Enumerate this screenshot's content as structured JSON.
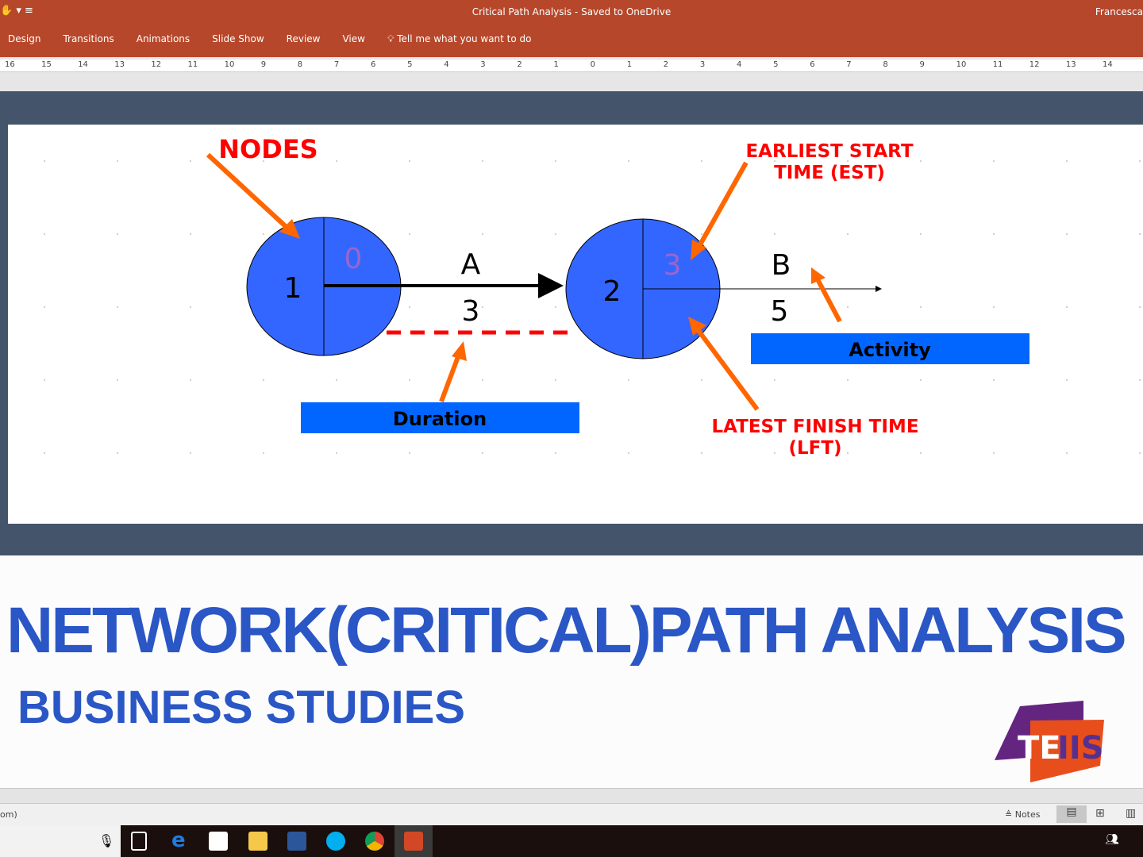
{
  "window": {
    "title": "Critical Path Analysis  -  Saved to OneDrive",
    "user": "Francesca"
  },
  "ribbon": {
    "tabs": [
      "Design",
      "Transitions",
      "Animations",
      "Slide Show",
      "Review",
      "View"
    ],
    "tell_me": "Tell me what you want to do"
  },
  "ruler": {
    "labels": [
      "16",
      "15",
      "14",
      "13",
      "12",
      "11",
      "10",
      "9",
      "8",
      "7",
      "6",
      "5",
      "4",
      "3",
      "2",
      "1",
      "0",
      "1",
      "2",
      "3",
      "4",
      "5",
      "6",
      "7",
      "8",
      "9",
      "10",
      "11",
      "12",
      "13",
      "14"
    ]
  },
  "diagram": {
    "label_nodes": "NODES",
    "label_est_1": "EARLIEST START",
    "label_est_2": "TIME (EST)",
    "label_lft_1": "LATEST FINISH TIME",
    "label_lft_2": "(LFT)",
    "node1": {
      "number": "1",
      "est": "0"
    },
    "node2": {
      "number": "2",
      "est": "3"
    },
    "activity_a": {
      "name": "A",
      "duration": "3"
    },
    "activity_b": {
      "name": "B",
      "duration": "5"
    },
    "box_activity": "Activity",
    "box_duration": "Duration",
    "colors": {
      "node": "#3366ff",
      "arrow": "#ff6600",
      "label": "#ff0000",
      "box": "#0066ff",
      "est": "#9966cc"
    }
  },
  "slide2": {
    "title": "NETWORK(CRITICAL)PATH ANALYSIS",
    "subtitle": "BUSINESS STUDIES",
    "logo": "TEIIS"
  },
  "status": {
    "left": "om)",
    "notes": "Notes"
  },
  "taskbar": {
    "apps": [
      "task-view",
      "edge",
      "store",
      "file-explorer",
      "word",
      "skype",
      "chrome",
      "powerpoint"
    ]
  }
}
